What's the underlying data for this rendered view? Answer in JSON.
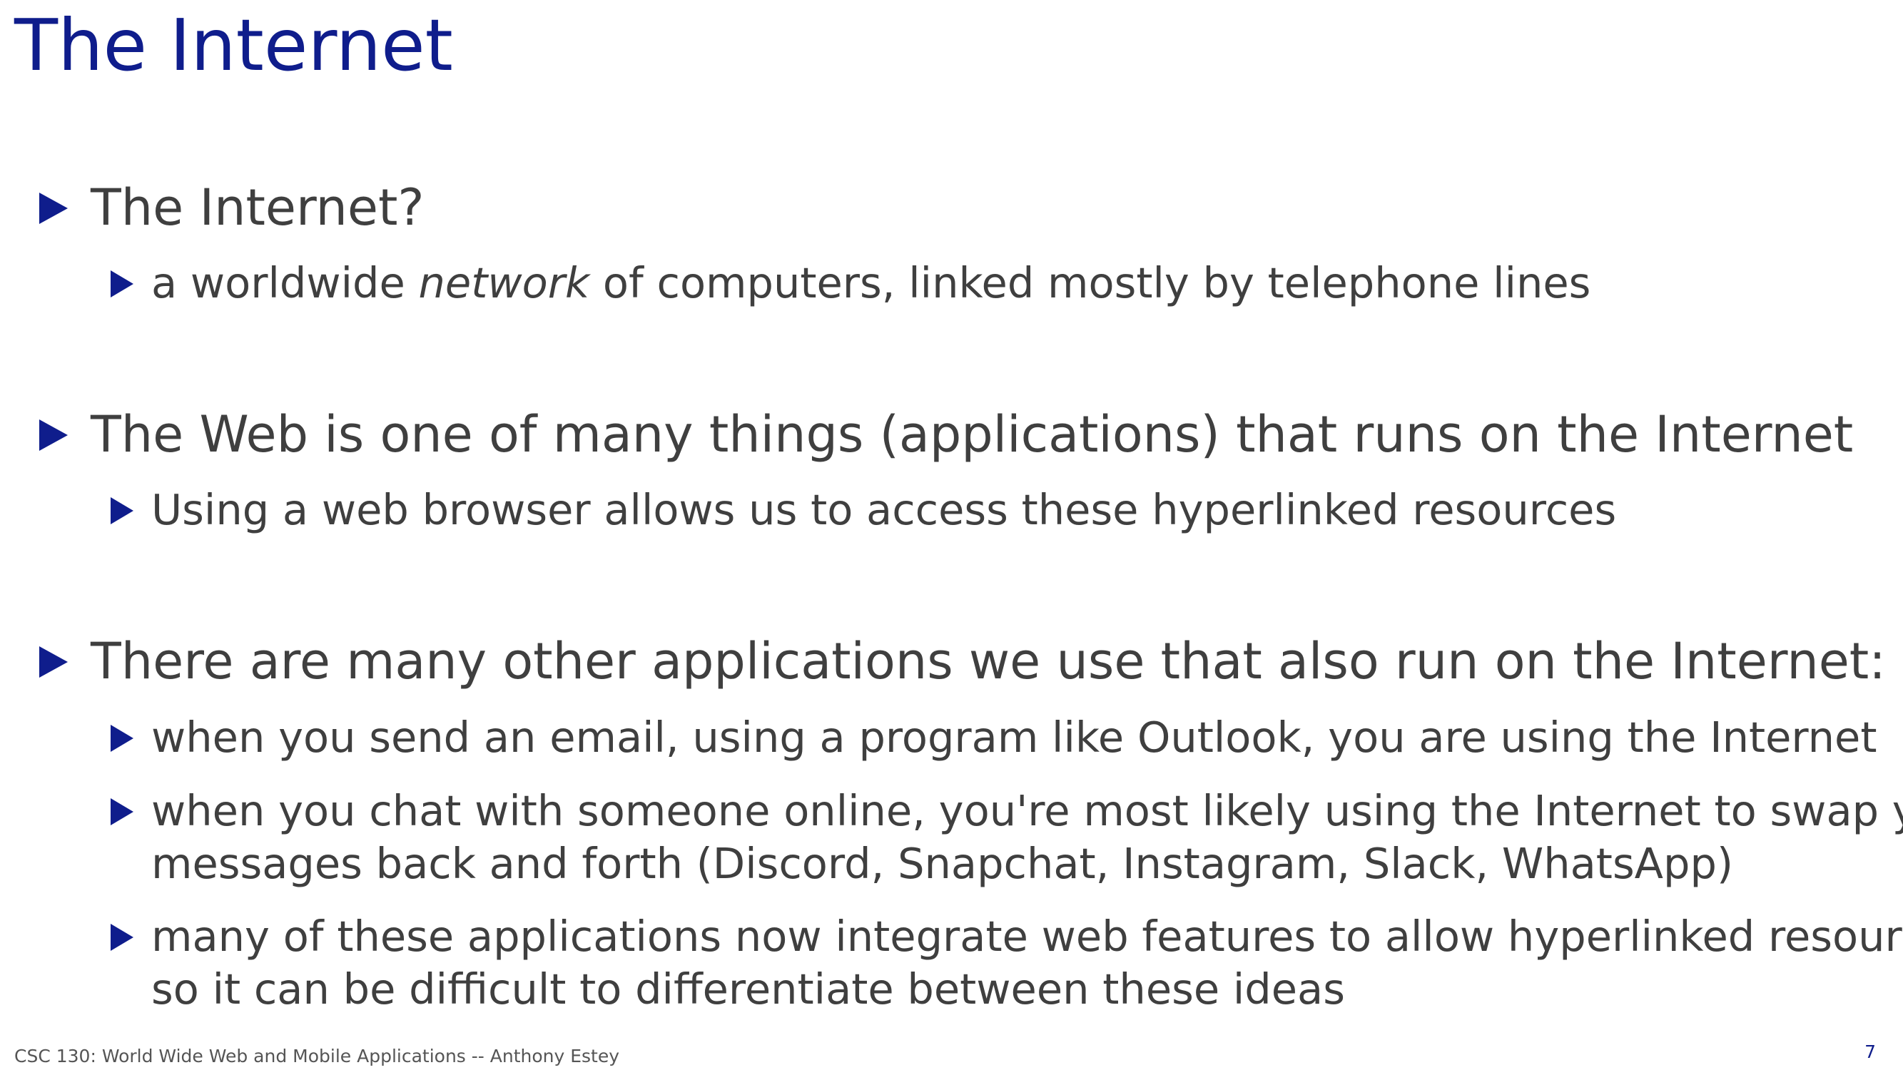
{
  "slide": {
    "title": "The Internet",
    "bullets": [
      {
        "text": "The Internet?",
        "sub": [
          {
            "pre": "a worldwide ",
            "em": "network",
            "post": " of computers, linked mostly by telephone lines"
          }
        ]
      },
      {
        "text": "The Web is one of many things (applications) that runs on the Internet",
        "sub": [
          {
            "lines": [
              "Using a web browser allows us to access these hyperlinked resources"
            ]
          }
        ]
      },
      {
        "text": "There are many other applications we use that also run on the Internet:",
        "sub": [
          {
            "lines": [
              "when you send an email, using a program like Outlook, you are using the Internet"
            ]
          },
          {
            "lines": [
              "when you chat with someone online, you're most likely using the Internet to swap your",
              "messages back and forth (Discord, Snapchat, Instagram, Slack, WhatsApp)"
            ]
          },
          {
            "lines": [
              "many of these applications now integrate web features to allow hyperlinked resources,",
              "so it can be difficult to differentiate between these ideas"
            ]
          }
        ]
      }
    ]
  },
  "footer": {
    "text": "CSC 130: World Wide Web and Mobile Applications -- Anthony Estey",
    "page_number": "7"
  },
  "colors": {
    "title": "#0f1d8c",
    "bullet_marker": "#0f1d8c",
    "body_text": "#3f3f3f"
  },
  "icons": {
    "bullet_marker": "triangle-right-icon"
  }
}
